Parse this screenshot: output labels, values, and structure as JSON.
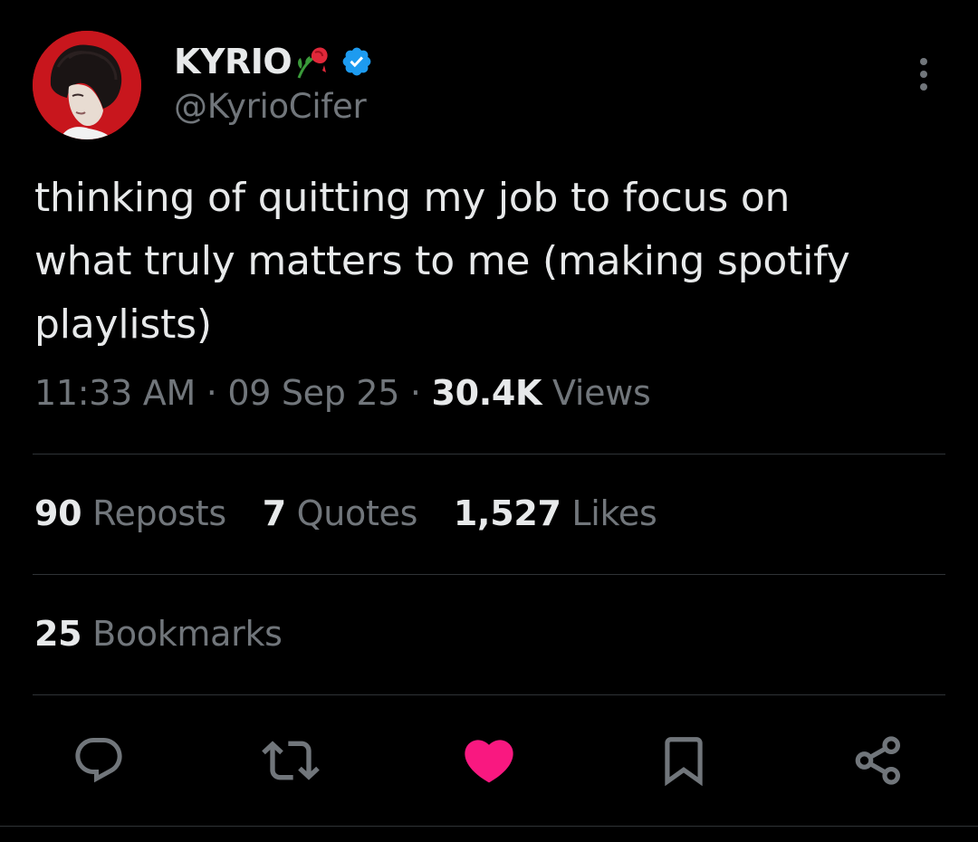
{
  "author": {
    "display_name": "KYRIO",
    "handle": "@KyrioCifer",
    "verified": true,
    "name_emoji": "rose-icon",
    "avatar_color": "#c8161d"
  },
  "tweet": {
    "text": "thinking of quitting my job to focus on\nwhat truly matters to me (making spotify\nplaylists)",
    "time": "11:33 AM",
    "date": "09 Sep 25",
    "separator": "·",
    "views_count": "30.4K",
    "views_label": "Views"
  },
  "stats": {
    "reposts_count": "90",
    "reposts_label": "Reposts",
    "quotes_count": "7",
    "quotes_label": "Quotes",
    "likes_count": "1,527",
    "likes_label": "Likes",
    "bookmarks_count": "25",
    "bookmarks_label": "Bookmarks"
  },
  "actions": [
    "reply-icon",
    "repost-icon",
    "like-icon",
    "bookmark-icon",
    "share-icon"
  ],
  "colors": {
    "background": "#000000",
    "primary_text": "#e7e9ea",
    "secondary_text": "#71767b",
    "divider": "#2f3336",
    "verified_blue": "#1d9bf0",
    "like_pink": "#f91880"
  }
}
